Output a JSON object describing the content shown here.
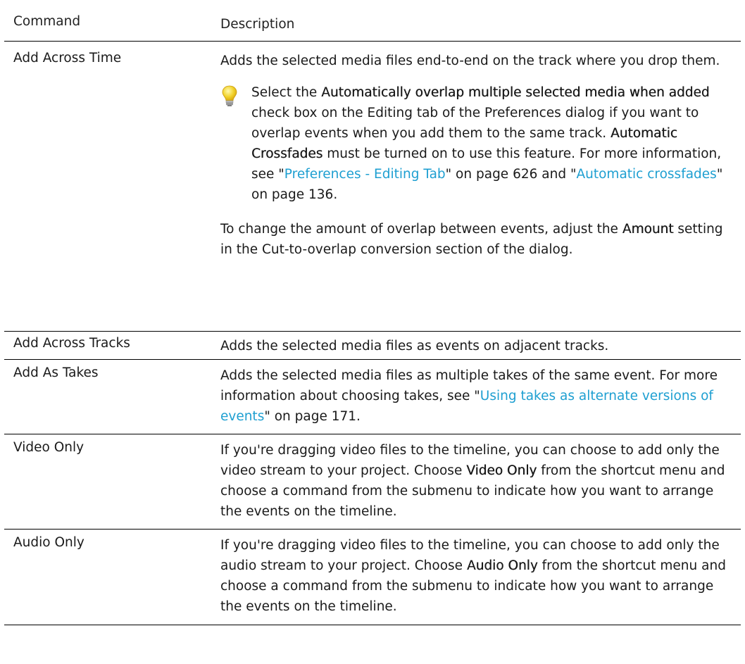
{
  "header": {
    "command": "Command",
    "description": "Description"
  },
  "rows": [
    {
      "command": "Add Across Time",
      "p1": "Adds the selected media files end-to-end on the track where you drop them.",
      "tip": {
        "pre": "Select the ",
        "bold1": "Automatically overlap multiple selected media when added",
        "mid1": " check box on the Editing tab of the Preferences dialog if you want to overlap events when you add them to the same track. ",
        "bold2": "Automatic Crossfades",
        "mid2": " must be turned on to use this feature. For more information, see \"",
        "link1": "Preferences - Editing Tab",
        "mid3": "\" on page 626 and \"",
        "link2": "Automatic crossfades",
        "post": "\" on page 136."
      },
      "p2": {
        "pre": "To change the amount of overlap between events, adjust the ",
        "bold": "Amount",
        "post": " setting in the Cut-to-overlap conversion section of the dialog."
      }
    },
    {
      "command": "Add Across Tracks",
      "desc": "Adds the selected media files as events on adjacent tracks."
    },
    {
      "command": "Add As Takes",
      "pre": "Adds the selected media files as multiple takes of the same event. For more information about choosing takes, see \"",
      "link": "Using takes as alternate versions of events",
      "post": "\" on page 171."
    },
    {
      "command": "Video Only",
      "pre": "If you're dragging video files to the timeline, you can choose to add only the video stream to your project. Choose ",
      "bold": "Video Only",
      "post": " from the shortcut menu and choose a command from the submenu to indicate how you want to arrange the events on the timeline."
    },
    {
      "command": "Audio Only",
      "pre": "If you're dragging video files to the timeline, you can choose to add only the audio stream to your project. Choose ",
      "bold": "Audio Only",
      "post": " from the shortcut menu and choose a command from the submenu to indicate how you want to arrange the events on the timeline."
    }
  ],
  "colors": {
    "link": "#1e9fd1",
    "rule": "#000000",
    "bulb": "#f2d32c"
  },
  "icons": {
    "tip": "lightbulb-icon"
  }
}
